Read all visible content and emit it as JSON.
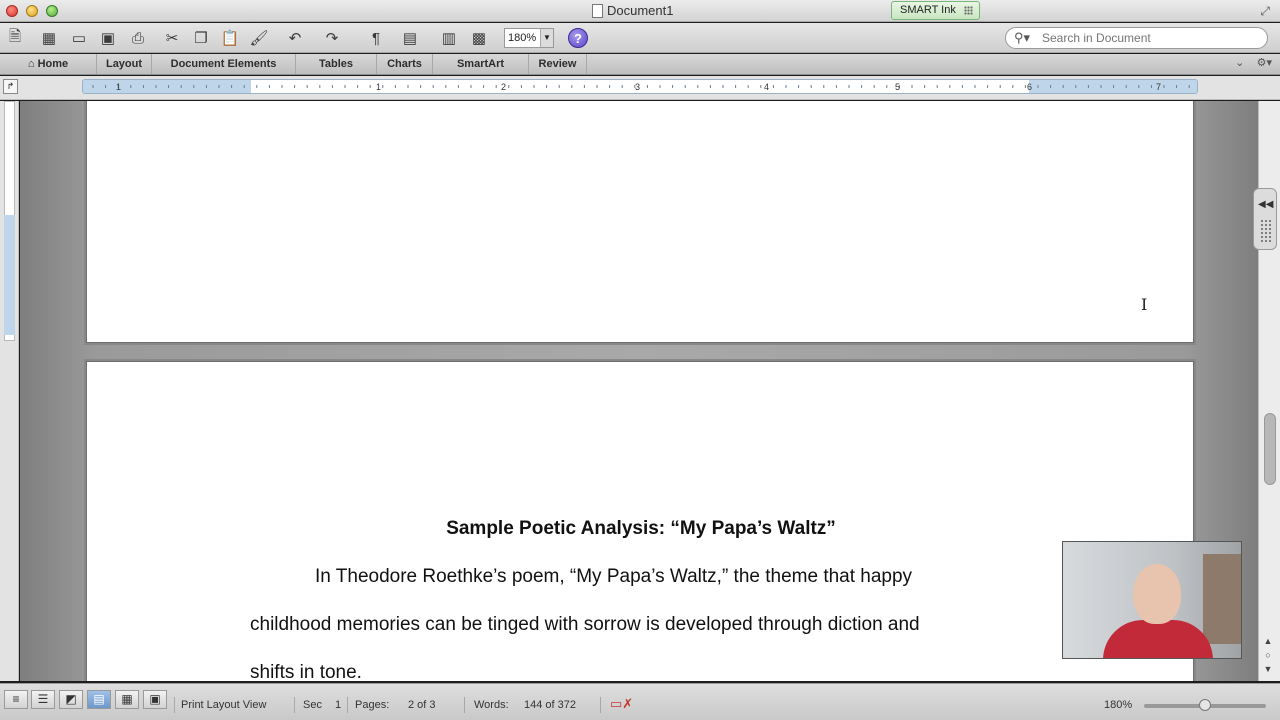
{
  "window": {
    "title": "Document1",
    "smart_ink": "SMART Ink"
  },
  "toolbar": {
    "zoom": "180%",
    "help": "?",
    "search_placeholder": "Search in Document"
  },
  "ribbon": {
    "tabs": [
      "Home",
      "Layout",
      "Document Elements",
      "Tables",
      "Charts",
      "SmartArt",
      "Review"
    ]
  },
  "ruler": {
    "numbers": [
      "1",
      "1",
      "2",
      "3",
      "4",
      "5",
      "6",
      "7"
    ]
  },
  "document": {
    "heading": "Sample Poetic Analysis: “My Papa’s Waltz”",
    "lines": [
      "In Theodore Roethke’s poem, “My Papa’s Waltz,” the theme that happy",
      "childhood memories can be tinged with sorrow is developed through diction and",
      "shifts in tone."
    ]
  },
  "statusbar": {
    "view_name": "Print Layout View",
    "sec_label": "Sec",
    "sec_value": "1",
    "pages_label": "Pages:",
    "pages_value": "2 of 3",
    "words_label": "Words:",
    "words_value": "144 of 372",
    "zoom_value": "180%"
  },
  "colors": {
    "accent": "#6c97c9",
    "smart_ink_bg": "#c8e6c0",
    "canvas": "#a9a9a9"
  }
}
